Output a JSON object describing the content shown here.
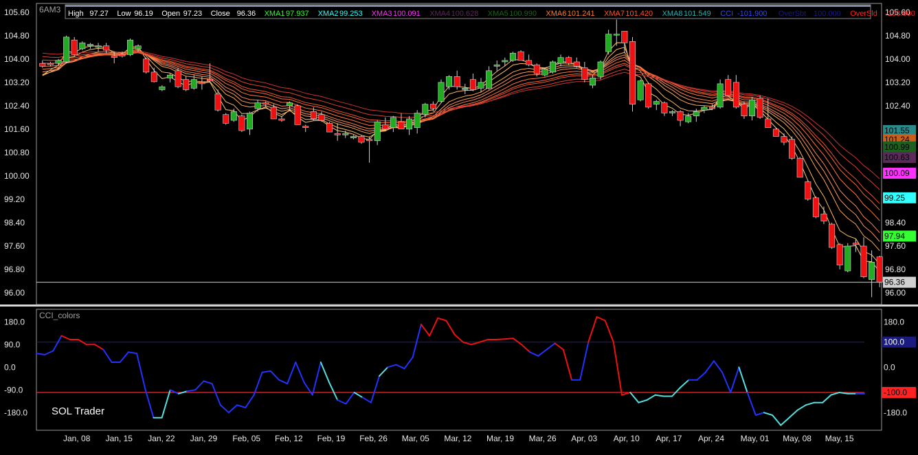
{
  "chart_data": [
    {
      "type": "candlestick",
      "symbol": "6AM3",
      "ylim": [
        95.6,
        105.9
      ],
      "y_ticks": [
        "105.60",
        "104.80",
        "104.00",
        "103.20",
        "102.40",
        "101.60",
        "100.80",
        "100.00",
        "99.20",
        "98.40",
        "97.60",
        "96.80",
        "96.00"
      ],
      "x_ticks": [
        "Jan, 08",
        "Jan, 15",
        "Jan, 22",
        "Jan, 29",
        "Feb, 05",
        "Feb, 12",
        "Feb, 19",
        "Feb, 26",
        "Mar, 05",
        "Mar, 12",
        "Mar, 19",
        "Mar, 26",
        "Apr, 03",
        "Apr, 10",
        "Apr, 17",
        "Apr, 24",
        "May, 01",
        "May, 08",
        "May, 15"
      ],
      "info": [
        {
          "label": "High",
          "value": "97.27",
          "color": "#ffffff"
        },
        {
          "label": "Low",
          "value": "96.19",
          "color": "#ffffff"
        },
        {
          "label": "Open",
          "value": "97.23",
          "color": "#ffffff"
        },
        {
          "label": "Close",
          "value": "96.36",
          "color": "#ffffff"
        },
        {
          "label": "XMA1",
          "value": "97.937",
          "color": "#33ff33"
        },
        {
          "label": "XMA2",
          "value": "99.253",
          "color": "#33ffff"
        },
        {
          "label": "XMA3",
          "value": "100.091",
          "color": "#ff33ff"
        },
        {
          "label": "XMA4",
          "value": "100.628",
          "color": "#5a2a5a"
        },
        {
          "label": "XMA5",
          "value": "100.990",
          "color": "#1f5f1f"
        },
        {
          "label": "XMA6",
          "value": "101.241",
          "color": "#ff7a33"
        },
        {
          "label": "XMA7",
          "value": "101.420",
          "color": "#ff5533"
        },
        {
          "label": "XMA8",
          "value": "101.549",
          "color": "#33aaaa"
        },
        {
          "label": "CCI",
          "value": "-101.900",
          "color": "#3344ff"
        },
        {
          "label": "OverSbt",
          "value": "100.000",
          "color": "#1a1a80"
        },
        {
          "label": "OverSld",
          "value": "-100.000",
          "color": "#ff2222"
        }
      ],
      "right_labels": [
        {
          "value": "101.55",
          "text": "101.55",
          "bg": "#2a8a8a",
          "fg": "#000000"
        },
        {
          "value": "101.24",
          "text": "101.24",
          "bg": "#c8601c",
          "fg": "#000000"
        },
        {
          "value": "100.99",
          "text": "100.99",
          "bg": "#1f5f1f",
          "fg": "#000000"
        },
        {
          "value": "100.63",
          "text": "100.63",
          "bg": "#5a2a5a",
          "fg": "#000000"
        },
        {
          "value": "100.09",
          "text": "100.09",
          "bg": "#ff33ff",
          "fg": "#000000"
        },
        {
          "value": "99.25",
          "text": "99.25",
          "bg": "#33ffff",
          "fg": "#000000"
        },
        {
          "value": "97.94",
          "text": "97.94",
          "bg": "#33ff33",
          "fg": "#000000"
        },
        {
          "value": "96.36",
          "text": "96.36",
          "bg": "#d0d0d0",
          "fg": "#000000"
        }
      ],
      "last_close": 96.36,
      "candles": [
        [
          103.85,
          103.95,
          103.7,
          103.75
        ],
        [
          103.85,
          103.9,
          103.75,
          103.8
        ],
        [
          103.85,
          104.0,
          103.75,
          103.95
        ],
        [
          103.9,
          104.8,
          103.85,
          104.75
        ],
        [
          104.65,
          104.75,
          104.1,
          104.15
        ],
        [
          104.35,
          104.6,
          104.3,
          104.55
        ],
        [
          104.45,
          104.55,
          104.35,
          104.5
        ],
        [
          104.4,
          104.55,
          104.25,
          104.45
        ],
        [
          104.45,
          104.55,
          104.2,
          104.3
        ],
        [
          104.1,
          104.25,
          103.85,
          104.05
        ],
        [
          104.15,
          104.25,
          104.05,
          104.1
        ],
        [
          104.15,
          104.7,
          104.1,
          104.65
        ],
        [
          104.35,
          104.5,
          104.25,
          104.45
        ],
        [
          104.0,
          104.05,
          103.5,
          103.55
        ],
        [
          103.55,
          103.7,
          103.2,
          103.22
        ],
        [
          102.95,
          103.1,
          102.9,
          103.05
        ],
        [
          103.35,
          103.5,
          103.2,
          103.45
        ],
        [
          103.6,
          103.7,
          103.0,
          103.05
        ],
        [
          103.3,
          103.4,
          102.9,
          102.95
        ],
        [
          103.0,
          103.45,
          102.95,
          103.3
        ],
        [
          103.2,
          103.4,
          102.95,
          103.15
        ],
        [
          103.3,
          103.85,
          103.2,
          103.25
        ],
        [
          102.8,
          102.95,
          102.2,
          102.25
        ],
        [
          102.1,
          102.15,
          101.75,
          101.8
        ],
        [
          101.9,
          102.3,
          101.85,
          102.2
        ],
        [
          102.05,
          102.1,
          101.5,
          101.55
        ],
        [
          101.6,
          102.2,
          101.4,
          102.15
        ],
        [
          102.3,
          102.6,
          102.2,
          102.5
        ],
        [
          102.5,
          102.55,
          102.35,
          102.45
        ],
        [
          102.35,
          102.45,
          101.95,
          101.95
        ],
        [
          101.95,
          102.05,
          101.85,
          101.9
        ],
        [
          102.4,
          102.55,
          102.25,
          102.5
        ],
        [
          102.4,
          102.45,
          101.75,
          101.75
        ],
        [
          101.7,
          101.75,
          101.5,
          101.65
        ],
        [
          102.2,
          102.35,
          101.9,
          101.95
        ],
        [
          102.1,
          102.2,
          101.85,
          101.9
        ],
        [
          101.8,
          101.85,
          101.5,
          101.5
        ],
        [
          101.45,
          101.8,
          101.2,
          101.4
        ],
        [
          101.4,
          101.55,
          101.3,
          101.45
        ],
        [
          101.3,
          101.4,
          101.25,
          101.35
        ],
        [
          101.35,
          101.4,
          101.1,
          101.15
        ],
        [
          101.25,
          101.35,
          100.45,
          101.2
        ],
        [
          101.2,
          101.9,
          101.05,
          101.85
        ],
        [
          101.75,
          102.0,
          101.6,
          101.6
        ],
        [
          101.65,
          102.05,
          101.5,
          102.0
        ],
        [
          101.85,
          102.15,
          101.6,
          101.6
        ],
        [
          101.6,
          102.05,
          101.4,
          101.95
        ],
        [
          101.65,
          102.25,
          101.45,
          102.15
        ],
        [
          102.1,
          102.5,
          102.0,
          102.45
        ],
        [
          102.45,
          102.55,
          102.2,
          102.3
        ],
        [
          102.55,
          103.3,
          102.5,
          103.2
        ],
        [
          103.05,
          103.45,
          102.95,
          103.4
        ],
        [
          103.4,
          103.6,
          102.95,
          103.05
        ],
        [
          102.95,
          103.15,
          102.8,
          103.0
        ],
        [
          103.3,
          103.5,
          102.9,
          102.95
        ],
        [
          103.0,
          103.35,
          102.85,
          103.2
        ],
        [
          103.0,
          103.75,
          102.95,
          103.6
        ],
        [
          103.75,
          103.95,
          103.6,
          103.8
        ],
        [
          103.9,
          104.05,
          103.75,
          103.95
        ],
        [
          103.95,
          104.25,
          103.9,
          104.2
        ],
        [
          104.25,
          104.3,
          103.95,
          103.95
        ],
        [
          103.95,
          104.15,
          103.75,
          103.8
        ],
        [
          103.8,
          103.85,
          103.4,
          103.5
        ],
        [
          103.45,
          103.7,
          103.4,
          103.65
        ],
        [
          103.55,
          103.95,
          103.5,
          103.9
        ],
        [
          103.85,
          104.15,
          103.75,
          104.05
        ],
        [
          104.05,
          104.1,
          103.8,
          103.85
        ],
        [
          103.9,
          104.05,
          103.7,
          103.75
        ],
        [
          103.7,
          103.9,
          103.2,
          103.3
        ],
        [
          103.1,
          103.45,
          103.0,
          103.35
        ],
        [
          103.4,
          103.95,
          103.3,
          103.9
        ],
        [
          104.25,
          105.0,
          104.15,
          104.85
        ],
        [
          104.85,
          105.35,
          104.45,
          104.85
        ],
        [
          104.95,
          104.95,
          104.2,
          104.55
        ],
        [
          104.6,
          104.75,
          102.2,
          102.45
        ],
        [
          102.6,
          103.3,
          102.55,
          103.25
        ],
        [
          103.15,
          103.2,
          102.3,
          102.35
        ],
        [
          102.45,
          102.6,
          102.25,
          102.55
        ],
        [
          102.5,
          102.55,
          102.05,
          102.15
        ],
        [
          102.15,
          102.25,
          102.05,
          102.2
        ],
        [
          102.2,
          102.25,
          101.7,
          101.9
        ],
        [
          101.85,
          102.15,
          101.8,
          102.05
        ],
        [
          102.05,
          102.3,
          101.85,
          102.2
        ],
        [
          102.25,
          102.4,
          102.15,
          102.35
        ],
        [
          102.35,
          102.45,
          102.25,
          102.3
        ],
        [
          102.35,
          103.3,
          102.3,
          103.15
        ],
        [
          103.3,
          103.45,
          102.7,
          102.75
        ],
        [
          103.2,
          103.45,
          102.3,
          102.35
        ],
        [
          102.45,
          102.55,
          101.95,
          102.05
        ],
        [
          102.05,
          102.7,
          101.9,
          102.6
        ],
        [
          102.65,
          102.75,
          101.95,
          102.0
        ],
        [
          101.95,
          102.65,
          101.65,
          101.65
        ],
        [
          101.6,
          101.65,
          101.35,
          101.35
        ],
        [
          101.35,
          101.45,
          101.05,
          101.15
        ],
        [
          101.25,
          101.35,
          100.55,
          100.6
        ],
        [
          100.6,
          100.65,
          99.95,
          99.95
        ],
        [
          99.8,
          99.85,
          99.15,
          99.2
        ],
        [
          99.25,
          99.3,
          98.55,
          98.6
        ],
        [
          98.7,
          98.95,
          98.35,
          98.45
        ],
        [
          98.35,
          98.4,
          97.5,
          97.55
        ],
        [
          97.65,
          97.7,
          96.8,
          96.95
        ],
        [
          96.75,
          97.7,
          96.7,
          97.6
        ],
        [
          97.7,
          97.85,
          97.4,
          97.65
        ],
        [
          97.6,
          97.9,
          96.5,
          96.55
        ],
        [
          96.45,
          97.45,
          95.85,
          97.05
        ],
        [
          97.23,
          97.27,
          96.19,
          96.36
        ]
      ],
      "ema_periods": [
        3,
        5,
        8,
        10,
        12,
        15,
        18,
        20,
        25,
        30
      ],
      "ema_colors": [
        "#ffc878",
        "#ffbb66",
        "#ffaa55",
        "#ff9966",
        "#ff8855",
        "#ff7744",
        "#ff6633",
        "#ee5533",
        "#dd4433",
        "#cc3333"
      ]
    },
    {
      "type": "line",
      "title": "CCI_colors",
      "ylim": [
        -250,
        230
      ],
      "y_ticks": [
        "180.0",
        "90.0",
        "0.0",
        "-90.0",
        "-180.0"
      ],
      "overbought": 100,
      "oversold": -100,
      "right_labels": [
        {
          "value": 100,
          "text": "100.0",
          "bg": "#1a1a80",
          "fg": "#ffffff"
        },
        {
          "value": -100,
          "text": "-100.0",
          "bg": "#ff2222",
          "fg": "#000000"
        }
      ],
      "values": [
        55,
        50,
        65,
        125,
        110,
        110,
        90,
        90,
        70,
        20,
        20,
        60,
        55,
        -85,
        -200,
        -200,
        -90,
        -105,
        -95,
        -90,
        -55,
        -65,
        -150,
        -180,
        -150,
        -160,
        -110,
        -20,
        -15,
        -50,
        -65,
        20,
        -60,
        -110,
        20,
        -60,
        -130,
        -145,
        -100,
        -120,
        -140,
        -35,
        0,
        10,
        -5,
        40,
        170,
        125,
        195,
        185,
        130,
        100,
        90,
        100,
        110,
        110,
        112,
        115,
        90,
        60,
        45,
        70,
        95,
        70,
        -50,
        -50,
        100,
        200,
        185,
        100,
        -110,
        -100,
        -140,
        -130,
        -110,
        -115,
        -115,
        -80,
        -50,
        -50,
        -20,
        25,
        -20,
        -100,
        0,
        -100,
        -190,
        -180,
        -190,
        -230,
        -200,
        -170,
        -150,
        -140,
        -140,
        -110,
        -100,
        -105,
        -105,
        -105
      ],
      "colors": [
        "B",
        "B",
        "B",
        "R",
        "R",
        "R",
        "R",
        "R",
        "B",
        "B",
        "B",
        "B",
        "B",
        "B",
        "C",
        "C",
        "B",
        "C",
        "B",
        "B",
        "B",
        "B",
        "B",
        "B",
        "B",
        "B",
        "B",
        "B",
        "B",
        "B",
        "B",
        "B",
        "B",
        "B",
        "C",
        "C",
        "B",
        "B",
        "C",
        "B",
        "B",
        "C",
        "B",
        "B",
        "B",
        "B",
        "R",
        "R",
        "R",
        "R",
        "R",
        "R",
        "R",
        "R",
        "R",
        "R",
        "R",
        "R",
        "R",
        "B",
        "B",
        "B",
        "R",
        "R",
        "B",
        "B",
        "R",
        "R",
        "R",
        "R",
        "R",
        "C",
        "C",
        "C",
        "C",
        "C",
        "C",
        "C",
        "B",
        "B",
        "B",
        "B",
        "B",
        "B",
        "C",
        "B",
        "B",
        "C",
        "C",
        "C",
        "C",
        "C",
        "C",
        "C",
        "C",
        "C",
        "C",
        "C",
        "B",
        "B"
      ]
    }
  ],
  "labels": {
    "watermark": "SOL Trader"
  },
  "colors": {
    "up": "#22aa22",
    "down": "#ee1111",
    "cci_blue": "#2233ff",
    "cci_red": "#ee1111",
    "cci_cyan": "#55e0e0",
    "ob_line": "#1a1a90",
    "os_line": "#ff2222"
  }
}
